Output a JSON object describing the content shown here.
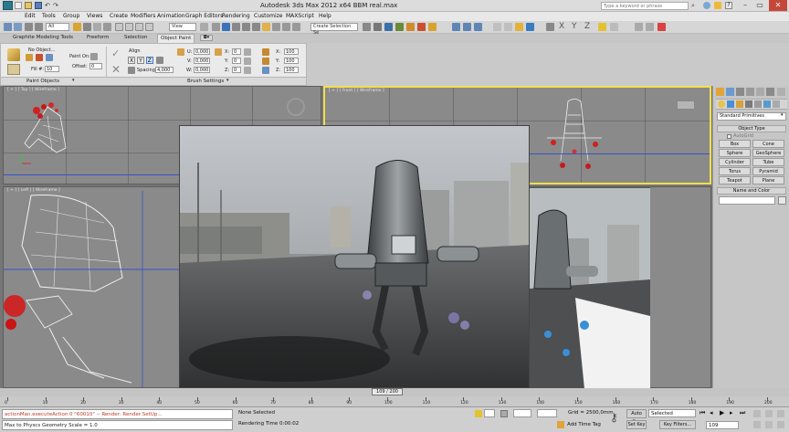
{
  "titlebar": {
    "title": "Autodesk 3ds Max  2012 x64      BBM real.max",
    "search_placeholder": "Type a keyword or phrase"
  },
  "menu": [
    "Edit",
    "Tools",
    "Group",
    "Views",
    "Create",
    "Modifiers",
    "Animation",
    "Graph Editors",
    "Rendering",
    "Customize",
    "MAXScript",
    "Help"
  ],
  "toolbar": {
    "filter_value": "All",
    "ref_coord": "View",
    "selection_set": "Create Selection Se"
  },
  "ribbon": {
    "tabs": [
      "Graphite Modeling Tools",
      "Freeform",
      "Selection",
      "Object Paint"
    ],
    "active_tab": "Object Paint",
    "no_object": "No Object...",
    "paint_on": "Paint On:",
    "fill_label": "Fill #:",
    "fill_value": "10",
    "offset_label": "Offset:",
    "offset_value": "0",
    "align": "Align",
    "spacing_label": "Spacing:",
    "spacing_value": "4,000",
    "u_label": "U:",
    "u_value": "0,000",
    "v_label": "V:",
    "v_value": "0,000",
    "w_label": "W:",
    "w_value": "0,000",
    "x_label": "X:",
    "x_value": "0",
    "y_label": "Y:",
    "y_value": "0",
    "z_label": "Z:",
    "z_value": "0",
    "xs_label": "X:",
    "xs_value": "100",
    "ys_label": "Y:",
    "ys_value": "100",
    "zs_label": "Z:",
    "zs_value": "100",
    "panel_paint_objects": "Paint Objects",
    "panel_brush_settings": "Brush Settings"
  },
  "viewports": {
    "top": "[ + ] [ Top ] [ Wireframe ]",
    "front": "[ + ] [ Front ] [ Wireframe ]",
    "left": "[ + ] [ Left ] [ Wireframe ]"
  },
  "cmdpanel": {
    "primitives": "Standard Primitives",
    "object_type": "Object Type",
    "autogrid": "AutoGrid",
    "buttons": [
      "Box",
      "Cone",
      "Sphere",
      "GeoSphere",
      "Cylinder",
      "Tube",
      "Torus",
      "Pyramid",
      "Teapot",
      "Plane"
    ],
    "name_and_color": "Name and Color"
  },
  "timeline": {
    "frame_display": "109 / 200",
    "ticks": [
      "0",
      "10",
      "20",
      "30",
      "40",
      "50",
      "60",
      "70",
      "80",
      "90",
      "100",
      "110",
      "120",
      "130",
      "140",
      "150",
      "160",
      "170",
      "180",
      "190",
      "200"
    ]
  },
  "status": {
    "script_line1": "actionMan.executeAction 0 \"60010\"  -- Render: Render SetUp...",
    "script_line2": "Max to Physcs Geometry Scale = 1.0",
    "none_selected": "None Selected",
    "rendering_time": "Rendering Time  0:00:02",
    "grid": "Grid = 2500,0mm",
    "add_time_tag": "Add Time Tag",
    "auto_key": "Auto Key",
    "selected": "Selected",
    "set_key": "Set Key",
    "key_filters": "Key Filters...",
    "frame_field": "109"
  },
  "colors": {
    "active_viewport": "#f2e04a",
    "close_button": "#c7463a",
    "autokey_red": "#b53030"
  }
}
